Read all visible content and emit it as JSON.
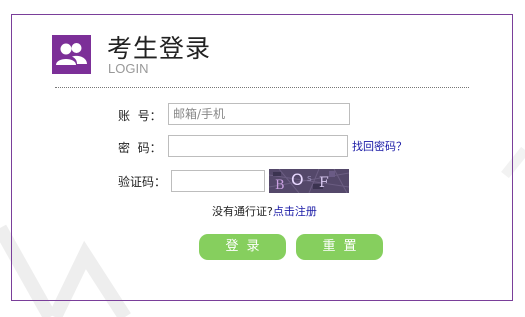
{
  "header": {
    "title": "考生登录",
    "subtitle": "LOGIN",
    "logo_icon": "users-icon"
  },
  "form": {
    "account_label": "账  号：",
    "account_placeholder": "邮箱/手机",
    "account_value": "",
    "password_label": "密  码：",
    "password_value": "",
    "forgot_link": "找回密码？",
    "captcha_label": "验证码：",
    "captcha_value": "",
    "captcha_icon": "captcha-image"
  },
  "register": {
    "prompt": "没有通行证?",
    "link": "点击注册"
  },
  "buttons": {
    "login": "登录",
    "reset": "重置"
  },
  "colors": {
    "accent_purple": "#7c2f98",
    "button_green": "#86cf5e",
    "link_blue": "#1a1aa6"
  }
}
